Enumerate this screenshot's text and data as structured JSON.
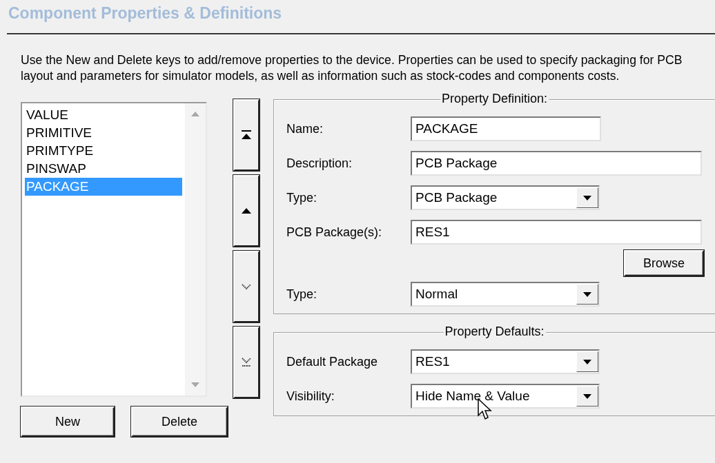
{
  "header": {
    "title": "Component Properties & Definitions"
  },
  "description": "Use the New and Delete keys to add/remove properties to the device. Properties can be used to specify packaging for PCB layout and parameters for simulator models, as well as information such as stock-codes and components costs.",
  "property_list": {
    "items": [
      {
        "label": "VALUE",
        "selected": false
      },
      {
        "label": "PRIMITIVE",
        "selected": false
      },
      {
        "label": "PRIMTYPE",
        "selected": false
      },
      {
        "label": "PINSWAP",
        "selected": false
      },
      {
        "label": "PACKAGE",
        "selected": true
      }
    ]
  },
  "move_buttons": [
    {
      "kind": "top"
    },
    {
      "kind": "up"
    },
    {
      "kind": "down"
    },
    {
      "kind": "bottom"
    }
  ],
  "list_buttons": [
    "New",
    "Delete"
  ],
  "property_definition": {
    "title": "Property Definition:",
    "rows": [
      {
        "kind": "short_text",
        "label": "Name:",
        "value": "PACKAGE"
      },
      {
        "kind": "text",
        "label": "Description:",
        "value": "PCB Package"
      },
      {
        "kind": "dropdown",
        "label": "Type:",
        "value": "PCB Package"
      },
      {
        "kind": "text",
        "label": "PCB Package(s):",
        "value": "RES1"
      },
      {
        "kind": "button",
        "label": "Browse"
      },
      {
        "kind": "dropdown",
        "label": "Type:",
        "value": "Normal"
      }
    ]
  },
  "property_defaults": {
    "title": "Property Defaults:",
    "rows": [
      {
        "kind": "dropdown",
        "label": "Default Package",
        "value": "RES1"
      },
      {
        "kind": "dropdown",
        "label": "Visibility:",
        "value": "Hide Name & Value"
      }
    ]
  }
}
